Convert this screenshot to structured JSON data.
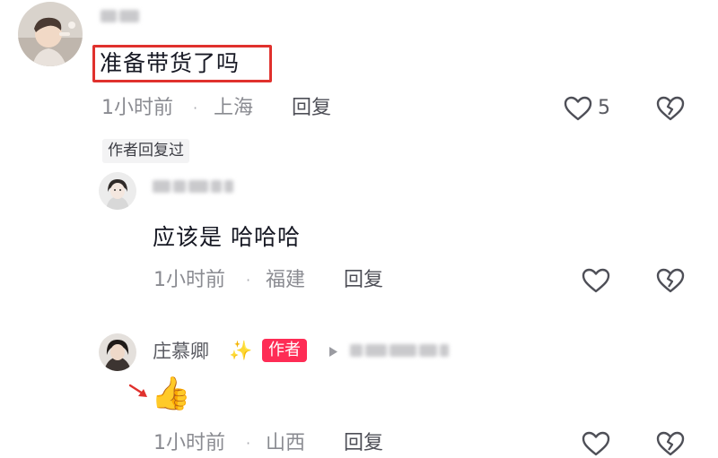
{
  "top_comment": {
    "text": "准备带货了吗",
    "time": "1小时前",
    "location": "上海",
    "reply_label": "回复",
    "like_count": "5",
    "author_replied_tag": "作者回复过"
  },
  "reply_1": {
    "text": "应该是 哈哈哈",
    "time": "1小时前",
    "location": "福建",
    "reply_label": "回复"
  },
  "reply_2": {
    "author_name": "庄慕卿",
    "sparkle_emoji": "✨",
    "author_badge": "作者",
    "text_emoji": "👍",
    "time": "1小时前",
    "location": "山西",
    "reply_label": "回复"
  },
  "separator_dot": "·",
  "colors": {
    "highlight_border": "#e0312d",
    "author_badge_bg": "#fe2c55",
    "meta_text": "#8a8b91"
  },
  "icons": [
    "heart-icon",
    "broken-heart-icon",
    "play-arrow-icon",
    "red-arrow-icon"
  ]
}
